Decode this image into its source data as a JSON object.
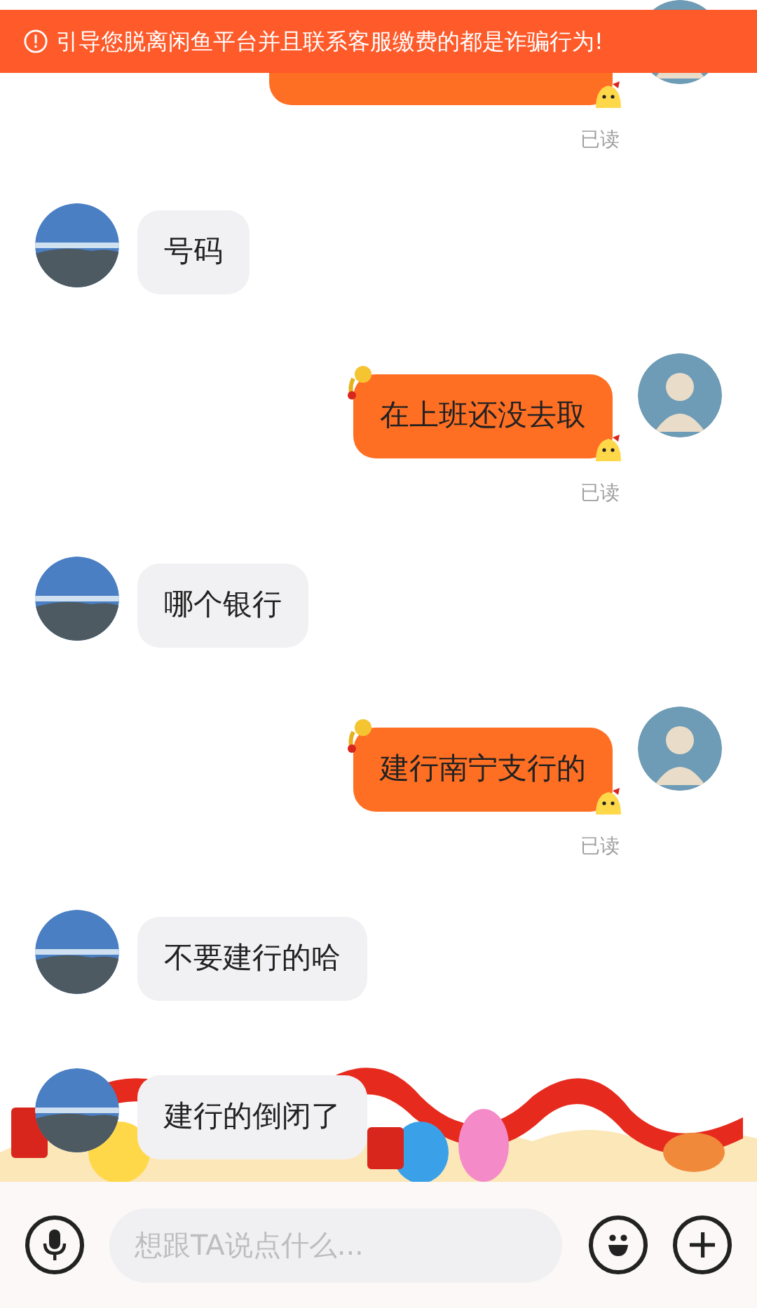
{
  "warning_banner": {
    "text": "引导您脱离闲鱼平台并且联系客服缴费的都是诈骗行为!"
  },
  "messages": [
    {
      "kind": "outgoing",
      "receipt": "已读"
    },
    {
      "kind": "incoming",
      "text": "号码"
    },
    {
      "kind": "outgoing",
      "text": "在上班还没去取",
      "receipt": "已读"
    },
    {
      "kind": "incoming",
      "text": "哪个银行"
    },
    {
      "kind": "outgoing",
      "text": "建行南宁支行的",
      "receipt": "已读"
    },
    {
      "kind": "incoming",
      "text": "不要建行的哈"
    },
    {
      "kind": "incoming",
      "text": "建行的倒闭了"
    }
  ],
  "composer": {
    "placeholder": "想跟TA说点什么..."
  }
}
